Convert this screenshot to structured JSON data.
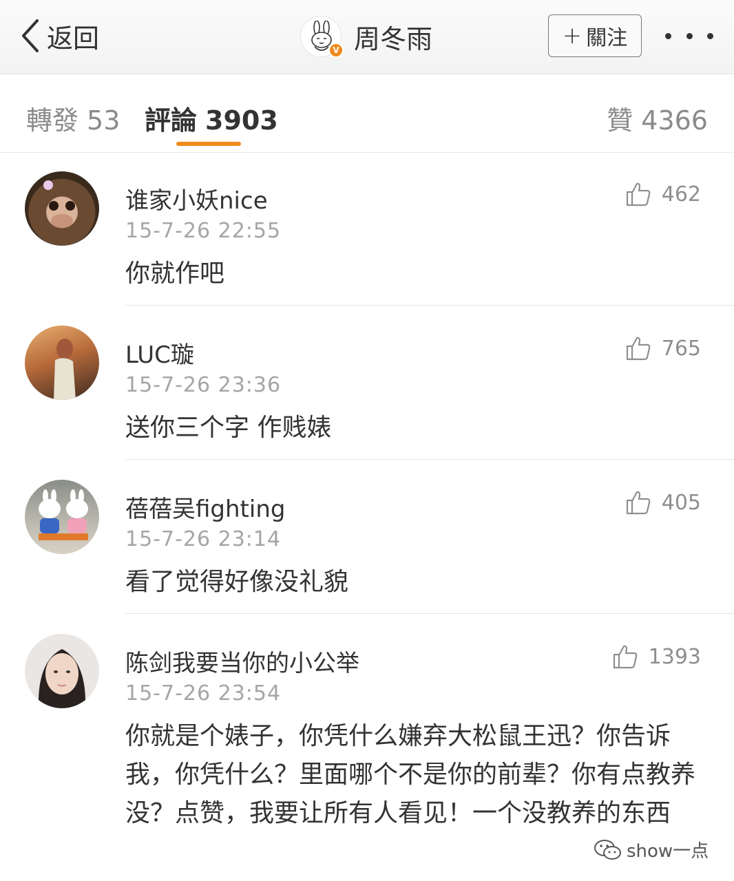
{
  "header": {
    "back_label": "返回",
    "title": "周冬雨",
    "verified_badge": "V",
    "follow_label": "關注",
    "follow_icon": "plus-icon",
    "more_icon": "more-dots-icon"
  },
  "tabs": [
    {
      "label": "轉發",
      "count": "53",
      "active": false
    },
    {
      "label": "評論",
      "count": "3903",
      "active": true
    },
    {
      "label": "贊",
      "count": "4366",
      "active": false
    }
  ],
  "colors": {
    "accent": "#f08a1c",
    "text": "#333333",
    "muted": "#a5a5a5"
  },
  "comments": [
    {
      "user": "谁家小妖nice",
      "time": "15-7-26 22:55",
      "text": "你就作吧",
      "likes": "462",
      "avatar": "monkey-avatar"
    },
    {
      "user": "LUC璇",
      "time": "15-7-26 23:36",
      "text": "送你三个字 作贱婊",
      "likes": "765",
      "avatar": "girl-sunset-avatar"
    },
    {
      "user": "蓓蓓吴fighting",
      "time": "15-7-26 23:14",
      "text": "看了觉得好像没礼貌",
      "likes": "405",
      "avatar": "miffy-avatar"
    },
    {
      "user": "陈剑我要当你的小公举",
      "time": "15-7-26 23:54",
      "text": "你就是个婊子，你凭什么嫌弃大松鼠王迅？你告诉我，你凭什么？里面哪个不是你的前辈？你有点教养没？点赞，我要让所有人看见！一个没教养的东西",
      "likes": "1393",
      "avatar": "girl-selfie-avatar"
    }
  ],
  "watermark": {
    "text": "show一点",
    "icon": "wechat-icon"
  }
}
